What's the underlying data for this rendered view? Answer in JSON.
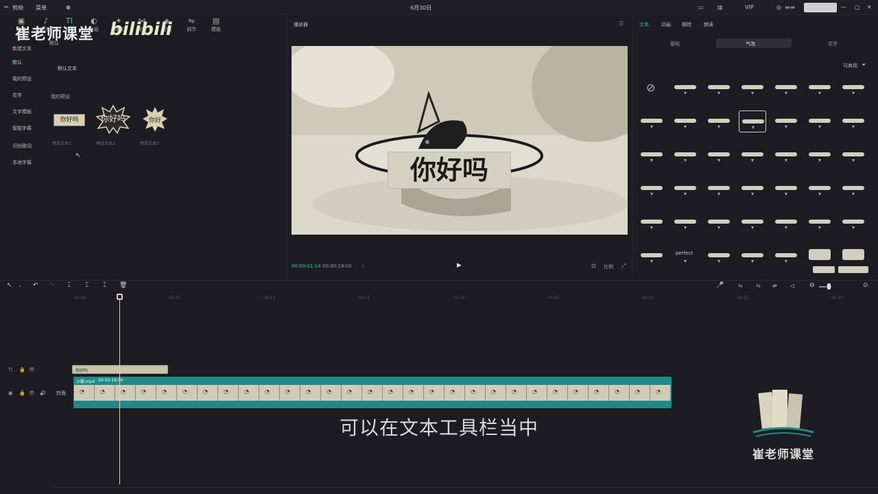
{
  "app": {
    "name": "剪映",
    "menu": "菜单",
    "date": "6月30日",
    "vip": "VIP"
  },
  "toolbar": [
    {
      "icon": "media-icon",
      "glyph": "▣",
      "label": "媒体"
    },
    {
      "icon": "audio-icon",
      "glyph": "♪",
      "label": "音频"
    },
    {
      "icon": "text-icon",
      "glyph": "TI",
      "label": "文本"
    },
    {
      "icon": "sticker-icon",
      "glyph": "◐",
      "label": "贴纸"
    },
    {
      "icon": "effects-icon",
      "glyph": "✦",
      "label": "特效"
    },
    {
      "icon": "transition-icon",
      "glyph": "⋈",
      "label": "转场"
    },
    {
      "icon": "filter-icon",
      "glyph": "◈",
      "label": "滤镜"
    },
    {
      "icon": "adjust-icon",
      "glyph": "⇋",
      "label": "调节"
    },
    {
      "icon": "template-icon",
      "glyph": "▤",
      "label": "模板"
    }
  ],
  "watermark": {
    "text": "崔老师课堂",
    "brand": "bilibili",
    "logo_text": "崔老师课堂"
  },
  "sidebar": [
    {
      "label": "新建文本",
      "active": false
    },
    {
      "label": "默认",
      "active": true
    },
    {
      "label": "我的预设",
      "active": false
    },
    {
      "label": "花字",
      "active": false
    },
    {
      "label": "文字模板",
      "active": false
    },
    {
      "label": "智能字幕",
      "active": false
    },
    {
      "label": "识别歌词",
      "active": false
    },
    {
      "label": "本地字幕",
      "active": false
    }
  ],
  "text_panel": {
    "sub_label": "默认",
    "default_text": "默认文本",
    "my_presets": "我的预设",
    "presets": [
      {
        "preview": "你好吗",
        "name": "预设文本1"
      },
      {
        "preview": "你好吗",
        "name": "预设文本2"
      },
      {
        "preview": "你好",
        "name": "预设文本3"
      }
    ]
  },
  "player": {
    "title": "播放器",
    "subtitle": "你好吗",
    "current_time": "00:00:01:14",
    "total_time": "00:00:19:00",
    "ratio_label": "比例"
  },
  "right_panel": {
    "tabs": [
      "文本",
      "动画",
      "跟踪",
      "朗读"
    ],
    "segments": [
      "基础",
      "气泡",
      "花字"
    ],
    "selected_segment": 1,
    "available_label": "可商用",
    "bubble_cell_text": "perfect",
    "selected_cell_index": 10
  },
  "timeline": {
    "ticks": [
      "00:00",
      "00:05",
      "00:10",
      "00:15",
      "00:20",
      "00:25",
      "00:30",
      "00:35",
      "00:40"
    ],
    "text_clip": "你好吗",
    "video_clip": {
      "name": "小猫.mp4",
      "duration": "00:00:19:00"
    },
    "cover_label": "封面",
    "caption": "可以在文本工具栏当中"
  },
  "colors": {
    "accent": "#1f8a86",
    "bg": "#1c1c22",
    "clip": "#cfcbb8"
  }
}
